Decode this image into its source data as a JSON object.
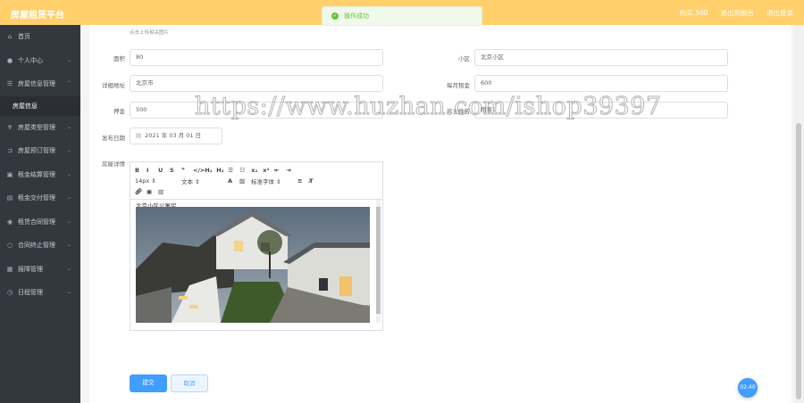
{
  "app": {
    "title": "房屋租赁平台"
  },
  "header": {
    "links": [
      "购买 500",
      "退出到前台",
      "退出登录"
    ]
  },
  "toast": {
    "message": "操作成功"
  },
  "sidebar": {
    "items": [
      {
        "label": "首页",
        "icon": "home-icon",
        "chev": ""
      },
      {
        "label": "个人中心",
        "icon": "user-icon",
        "chev": "⌄"
      },
      {
        "label": "房屋信息管理",
        "icon": "list-icon",
        "chev": "⌃"
      },
      {
        "label": "房屋类型管理",
        "icon": "tag-icon",
        "chev": "⌄"
      },
      {
        "label": "房屋预订管理",
        "icon": "calendar-icon",
        "chev": "⌄"
      },
      {
        "label": "租金结算管理",
        "icon": "card-icon",
        "chev": "⌄"
      },
      {
        "label": "租金交付管理",
        "icon": "money-icon",
        "chev": "⌄"
      },
      {
        "label": "租赁合同管理",
        "icon": "pin-icon",
        "chev": "⌄"
      },
      {
        "label": "合同终止管理",
        "icon": "circle-icon",
        "chev": "⌄"
      },
      {
        "label": "报障管理",
        "icon": "grid-icon",
        "chev": "⌄"
      },
      {
        "label": "日程管理",
        "icon": "clock-icon",
        "chev": "⌄"
      }
    ],
    "sub_item": "房屋信息"
  },
  "form": {
    "upload_tip": "点击上传相关图片",
    "area_label": "面积",
    "area_value": "80",
    "community_label": "小区",
    "community_value": "北京小区",
    "address_label": "详细地址",
    "address_value": "北京市",
    "rent_label": "每月租金",
    "rent_value": "600",
    "deposit_label": "押金",
    "deposit_value": "500",
    "owner_label": "房主姓名",
    "owner_value": "租客1",
    "date_label": "发布日期",
    "date_value": "2021 年 03 月 01 日",
    "detail_label": "房屋详情",
    "editor_text": "北京小区公寓房",
    "toolbar_row1": [
      "B",
      "I",
      "U",
      "S",
      "❞",
      "</>",
      "H₁",
      "H₂",
      "☰",
      "☷",
      "x₂",
      "x²",
      "⇤",
      "⇥"
    ],
    "toolbar_font_size": "14px",
    "toolbar_text_style": "文本",
    "toolbar_font_family": "标准字体",
    "submit_label": "提交",
    "cancel_label": "取消"
  },
  "clock": "02:40",
  "watermark": "https://www.huzhan.com/ishop39397"
}
